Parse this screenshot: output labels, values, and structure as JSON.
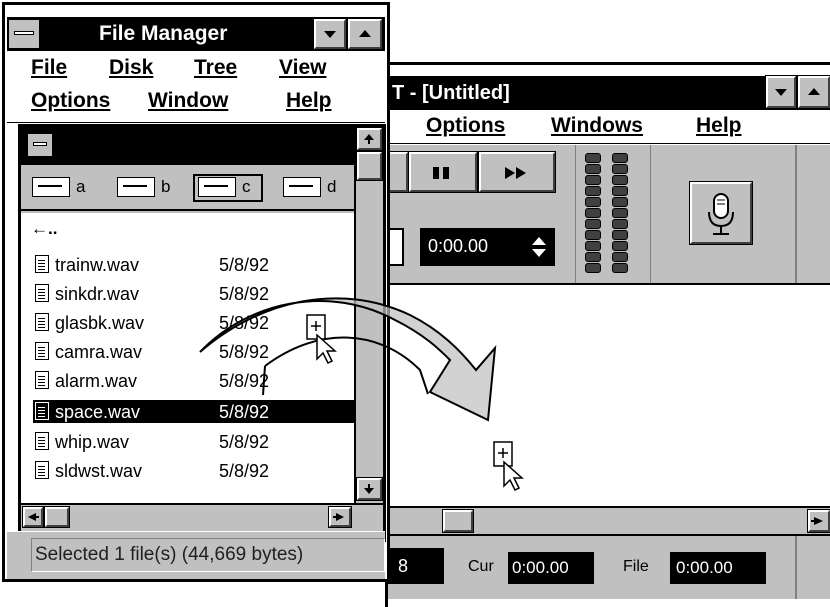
{
  "file_manager": {
    "title": "File Manager",
    "menu_row1": [
      "File",
      "Disk",
      "Tree",
      "View"
    ],
    "menu_row2": [
      "Options",
      "Window",
      "Help"
    ],
    "drives": [
      "a",
      "b",
      "c",
      "d"
    ],
    "parent_dir": "←..",
    "files": [
      {
        "name": "trainw.wav",
        "date": "5/8/92"
      },
      {
        "name": "sinkdr.wav",
        "date": "5/8/92"
      },
      {
        "name": "glasbk.wav",
        "date": "5/8/92"
      },
      {
        "name": "camra.wav",
        "date": "5/8/92"
      },
      {
        "name": "alarm.wav",
        "date": "5/8/92"
      },
      {
        "name": "space.wav",
        "date": "5/8/92"
      },
      {
        "name": "whip.wav",
        "date": "5/8/92"
      },
      {
        "name": "sldwst.wav",
        "date": "5/8/92"
      }
    ],
    "selected_index": 5,
    "status": "Selected 1 file(s) (44,669 bytes)"
  },
  "recorder": {
    "title": "T - [Untitled]",
    "menu": [
      "Options",
      "Windows",
      "Help"
    ],
    "time_value": "0:00.00",
    "status_partial": "8",
    "cur_label": "Cur",
    "cur_value": "0:00.00",
    "file_label": "File",
    "file_value": "0:00.00"
  },
  "icons": {
    "drag_arrow": "curved-arrow-icon",
    "drag_cursor": "drag-copy-cursor-icon",
    "microphone": "microphone-icon"
  }
}
